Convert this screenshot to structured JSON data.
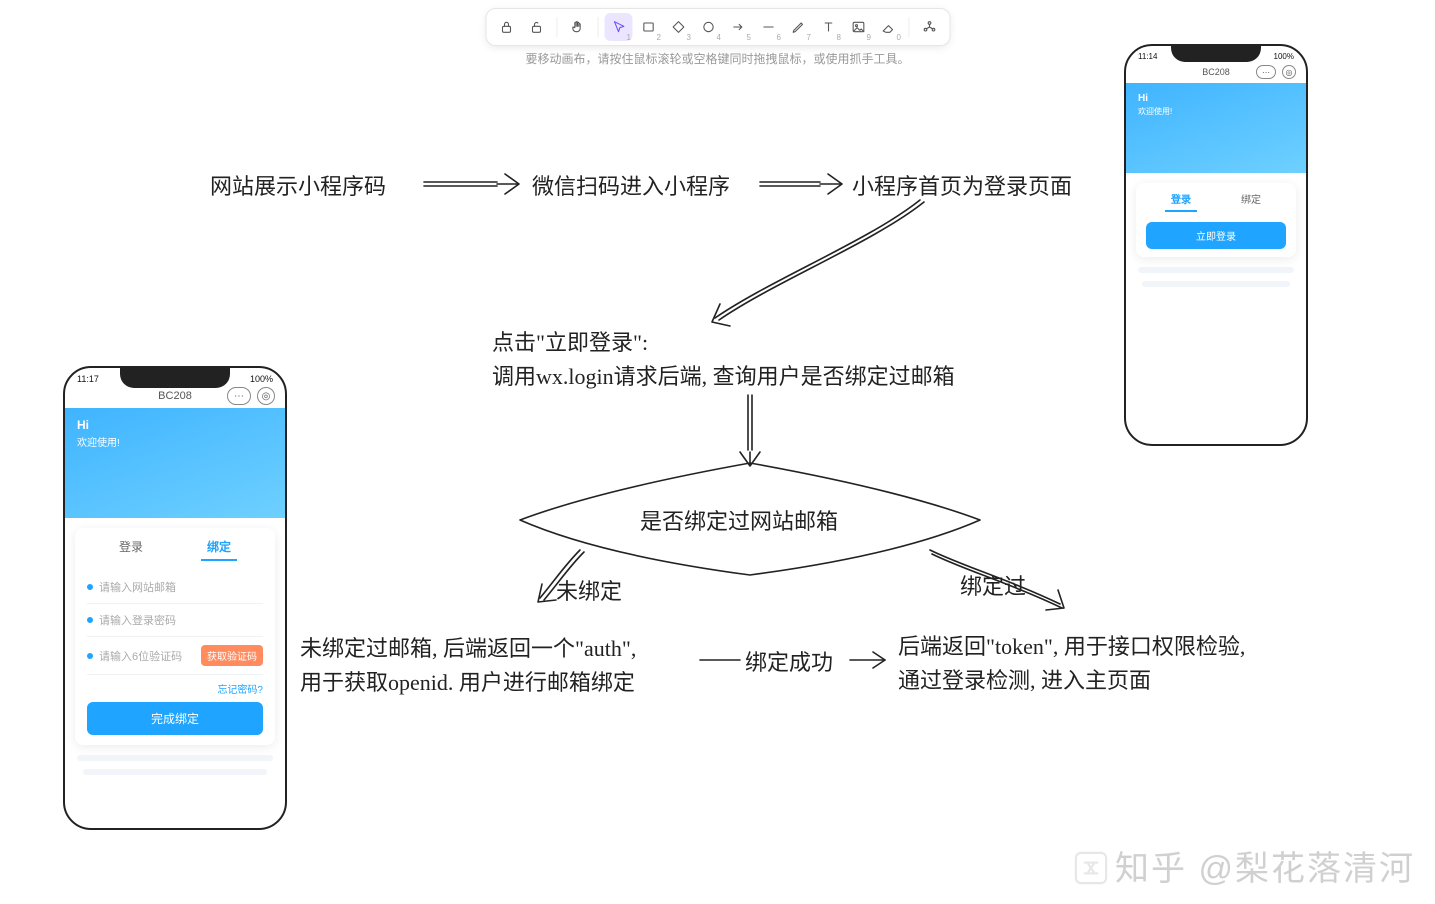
{
  "toolbar": {
    "hint": "要移动画布，请按住鼠标滚轮或空格键同时拖拽鼠标，或使用抓手工具。",
    "tools": [
      {
        "name": "lock-open-icon",
        "glyph": "lock",
        "num": ""
      },
      {
        "name": "lock-icon",
        "glyph": "unlock",
        "num": ""
      },
      {
        "name": "hand-icon",
        "glyph": "hand",
        "num": ""
      },
      {
        "name": "select-icon",
        "glyph": "cursor",
        "num": "1",
        "sel": true
      },
      {
        "name": "rect-icon",
        "glyph": "rect",
        "num": "2"
      },
      {
        "name": "diamond-icon",
        "glyph": "diamond",
        "num": "3"
      },
      {
        "name": "circle-icon",
        "glyph": "circle",
        "num": "4"
      },
      {
        "name": "arrow-icon",
        "glyph": "arrow",
        "num": "5"
      },
      {
        "name": "line-icon",
        "glyph": "line",
        "num": "6"
      },
      {
        "name": "pencil-icon",
        "glyph": "pencil",
        "num": "7"
      },
      {
        "name": "text-icon",
        "glyph": "text",
        "num": "8"
      },
      {
        "name": "image-icon",
        "glyph": "image",
        "num": "9"
      },
      {
        "name": "eraser-icon",
        "glyph": "eraser",
        "num": "0"
      },
      {
        "name": "library-icon",
        "glyph": "lib",
        "num": ""
      }
    ]
  },
  "flow": {
    "n1": "网站展示小程序码",
    "n2": "微信扫码进入小程序",
    "n3": "小程序首页为登录页面",
    "n4a": "点击\"立即登录\":",
    "n4b": "调用wx.login请求后端, 查询用户是否绑定过邮箱",
    "decision": "是否绑定过网站邮箱",
    "leftBranch": "未绑定",
    "rightBranch": "绑定过",
    "midArrow": "绑定成功",
    "leftResultA": "未绑定过邮箱, 后端返回一个\"auth\",",
    "leftResultB": "用于获取openid. 用户进行邮箱绑定",
    "rightResultA": "后端返回\"token\", 用于接口权限检验,",
    "rightResultB": "通过登录检测, 进入主页面"
  },
  "phoneA": {
    "time": "11:17",
    "battery": "100%",
    "title": "BC208",
    "hi": "Hi",
    "welcome": "欢迎使用!",
    "tabLogin": "登录",
    "tabBind": "绑定",
    "ph1": "请输入网站邮箱",
    "ph2": "请输入登录密码",
    "ph3": "请输入6位验证码",
    "getCode": "获取验证码",
    "forgot": "忘记密码?",
    "submit": "完成绑定"
  },
  "phoneB": {
    "time": "11:14",
    "battery": "100%",
    "title": "BC208",
    "hi": "Hi",
    "welcome": "欢迎使用!",
    "tabLogin": "登录",
    "tabBind": "绑定",
    "submit": "立即登录"
  },
  "watermark": {
    "site": "知乎",
    "author": "@梨花落清河"
  }
}
